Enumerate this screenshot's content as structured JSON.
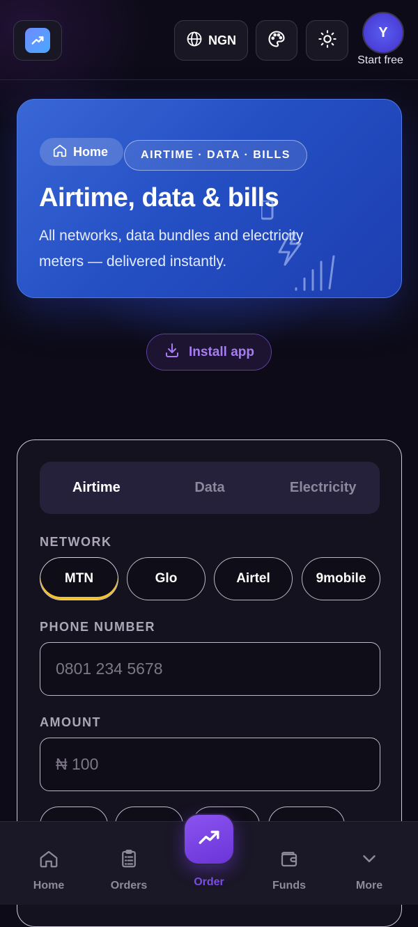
{
  "header": {
    "currency_label": "NGN",
    "avatar_initial": "Y",
    "avatar_caption": "Start free",
    "icons": [
      "trending-up-icon",
      "globe-icon",
      "palette-icon",
      "sun-icon"
    ]
  },
  "hero": {
    "home_chip": "Home",
    "tag": "AIRTIME · DATA · BILLS",
    "title": "Airtime, data & bills",
    "subtitle": "All networks, data bundles and electricity meters — delivered instantly."
  },
  "install": {
    "label": "Install app"
  },
  "form": {
    "tabs": [
      "Airtime",
      "Data",
      "Electricity"
    ],
    "active_tab": "Airtime",
    "network_label": "NETWORK",
    "networks": [
      "MTN",
      "Glo",
      "Airtel",
      "9mobile"
    ],
    "selected_network": "MTN",
    "phone_label": "PHONE NUMBER",
    "phone_placeholder": "0801 234 5678",
    "amount_label": "AMOUNT",
    "amount_placeholder": "₦ 100"
  },
  "nav": {
    "items": [
      "Home",
      "Orders",
      "Order",
      "Funds",
      "More"
    ],
    "active": "Order"
  },
  "colors": {
    "background": "#0d0b17",
    "hero_blue": "#2450c4",
    "accent_purple": "#7c4ee6",
    "mtn_yellow": "#f2c230"
  }
}
